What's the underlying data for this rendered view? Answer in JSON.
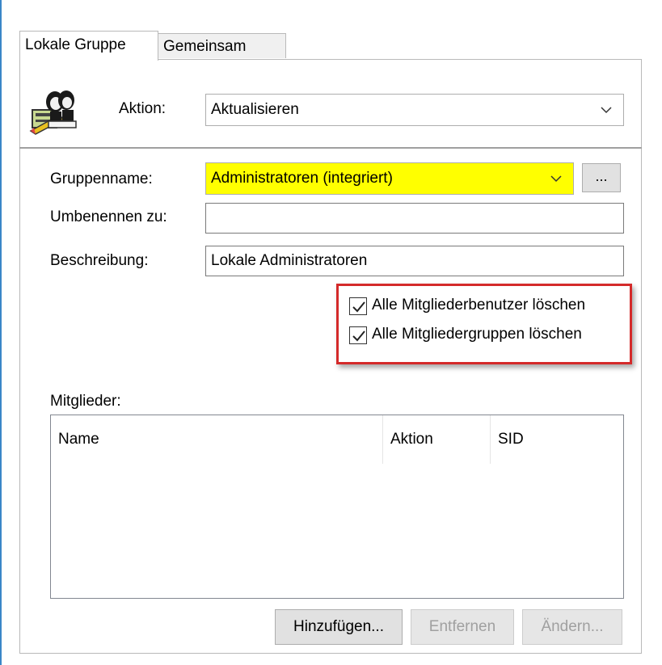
{
  "tabs": [
    {
      "label": "Lokale Gruppe",
      "active": true
    },
    {
      "label": "Gemeinsam",
      "active": false
    }
  ],
  "header": {
    "icon": "users-group-icon",
    "action_label": "Aktion:",
    "action_value": "Aktualisieren"
  },
  "form": {
    "group_name_label": "Gruppenname:",
    "group_name_value": "Administratoren (integriert)",
    "group_name_highlight_color": "#ffff00",
    "browse_label": "...",
    "rename_label": "Umbenennen zu:",
    "rename_value": "",
    "description_label": "Beschreibung:",
    "description_value": "Lokale Administratoren"
  },
  "options": {
    "highlight_color": "#d42a2a",
    "delete_member_users": {
      "label": "Alle Mitgliederbenutzer löschen",
      "checked": true
    },
    "delete_member_groups": {
      "label": "Alle Mitgliedergruppen löschen",
      "checked": true
    }
  },
  "members": {
    "label": "Mitglieder:",
    "columns": [
      "Name",
      "Aktion",
      "SID"
    ],
    "rows": []
  },
  "buttons": {
    "add": {
      "label": "Hinzufügen...",
      "enabled": true
    },
    "remove": {
      "label": "Entfernen",
      "enabled": false
    },
    "edit": {
      "label": "Ändern...",
      "enabled": false
    }
  }
}
